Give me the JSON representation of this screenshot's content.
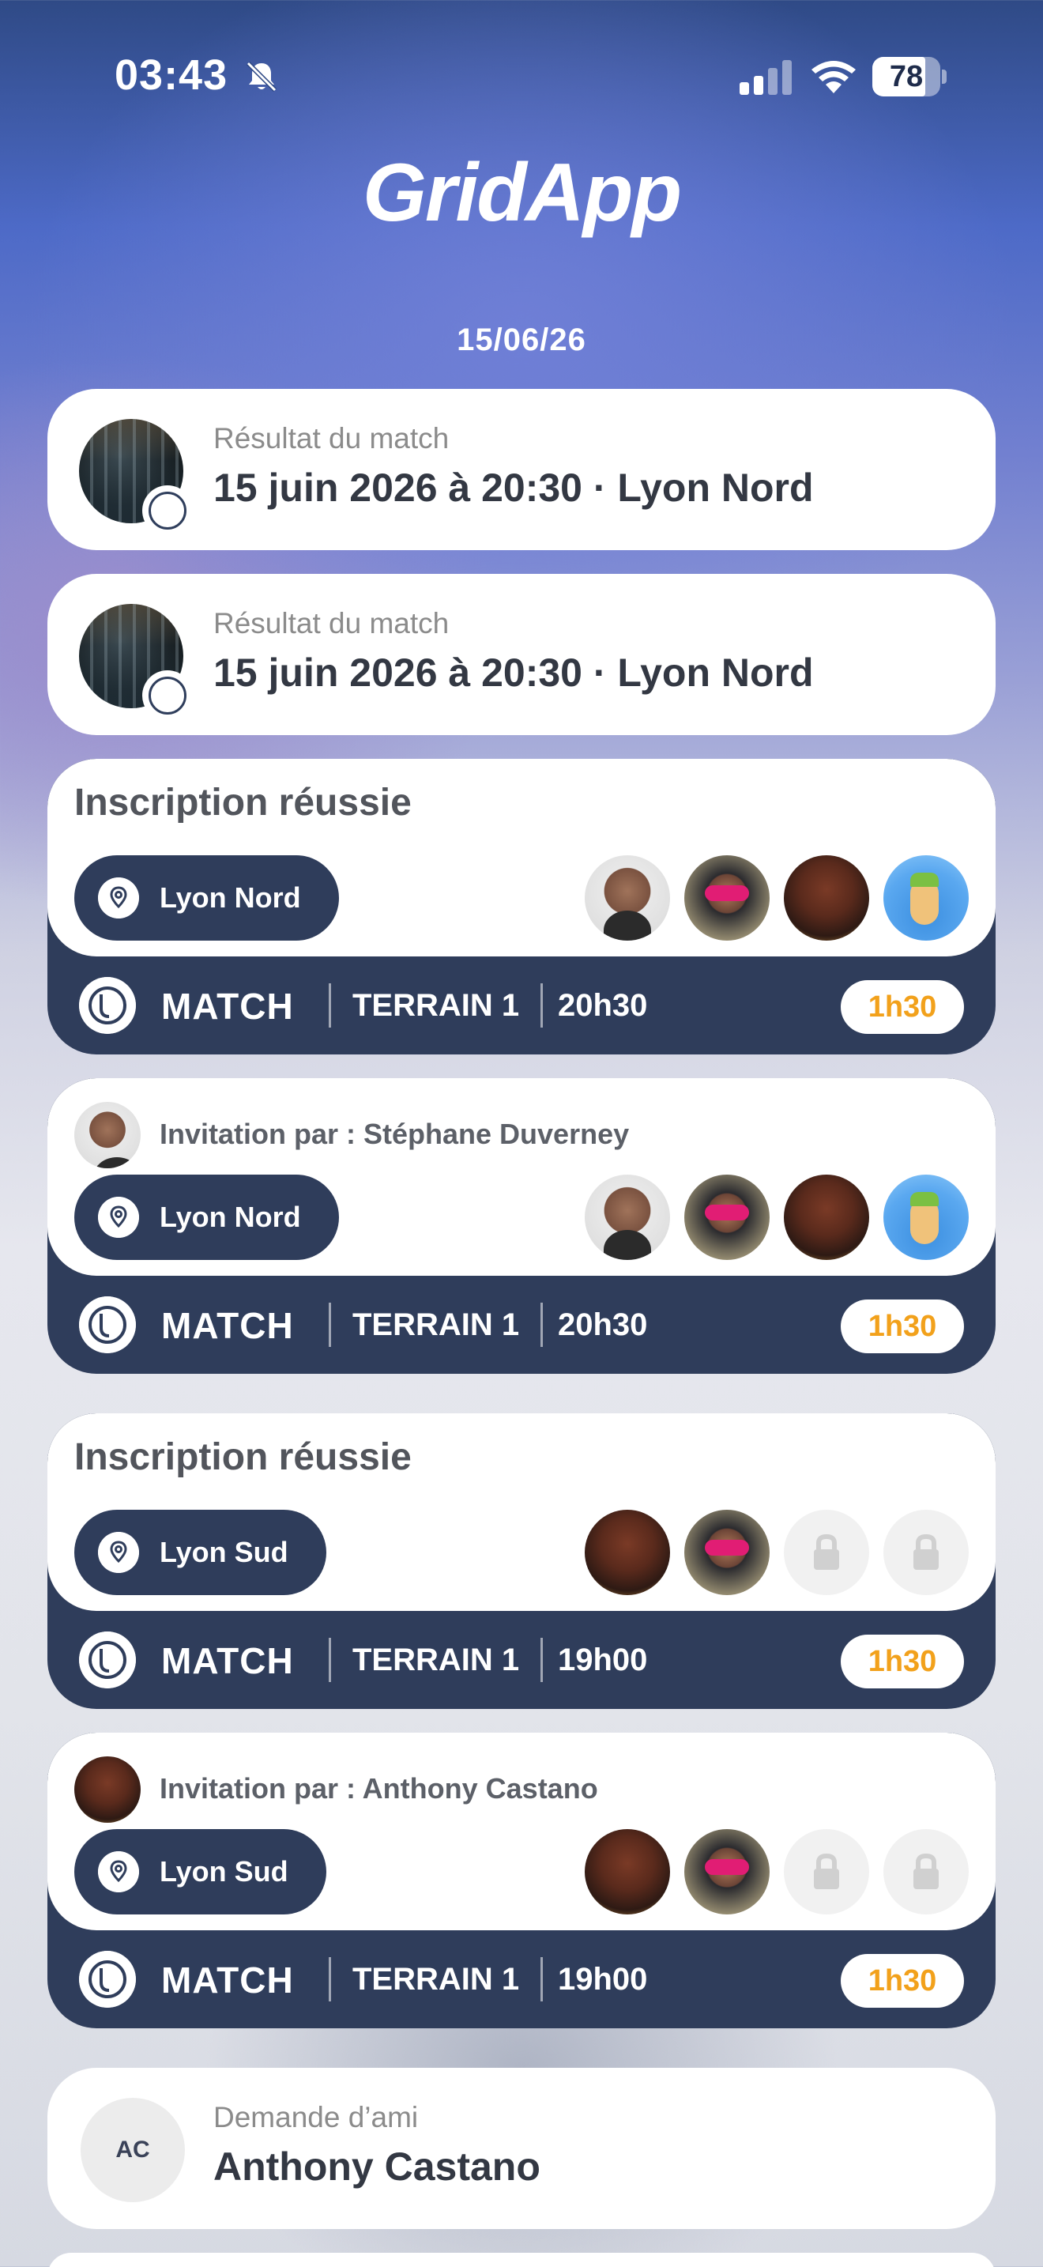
{
  "status_bar": {
    "time": "03:43",
    "battery": "78",
    "battery_level": 0.78
  },
  "app": {
    "logo": "GridApp"
  },
  "date": "15/06/26",
  "result_cards": [
    {
      "subtitle": "Résultat du match",
      "title": "15 juin 2026 à 20:30 · Lyon Nord"
    },
    {
      "subtitle": "Résultat du match",
      "title": "15 juin 2026 à 20:30 · Lyon Nord"
    }
  ],
  "match_cards": [
    {
      "heading": "Inscription réussie",
      "invite": "",
      "location": "Lyon Nord",
      "label": "MATCH",
      "terrain": "TERRAIN 1",
      "time": "20h30",
      "duration": "1h30"
    },
    {
      "heading": "",
      "invite": "Invitation par : Stéphane Duverney",
      "location": "Lyon Nord",
      "label": "MATCH",
      "terrain": "TERRAIN 1",
      "time": "20h30",
      "duration": "1h30"
    },
    {
      "heading": "Inscription réussie",
      "invite": "",
      "location": "Lyon Sud",
      "label": "MATCH",
      "terrain": "TERRAIN 1",
      "time": "19h00",
      "duration": "1h30"
    },
    {
      "heading": "",
      "invite": "Invitation par : Anthony Castano",
      "location": "Lyon Sud",
      "label": "MATCH",
      "terrain": "TERRAIN 1",
      "time": "19h00",
      "duration": "1h30"
    }
  ],
  "friend_request": {
    "initials": "AC",
    "subtitle": "Demande d’ami",
    "name": "Anthony Castano"
  },
  "colors": {
    "card_dark": "#2f3d5b",
    "duration_text": "#f2a11b"
  }
}
